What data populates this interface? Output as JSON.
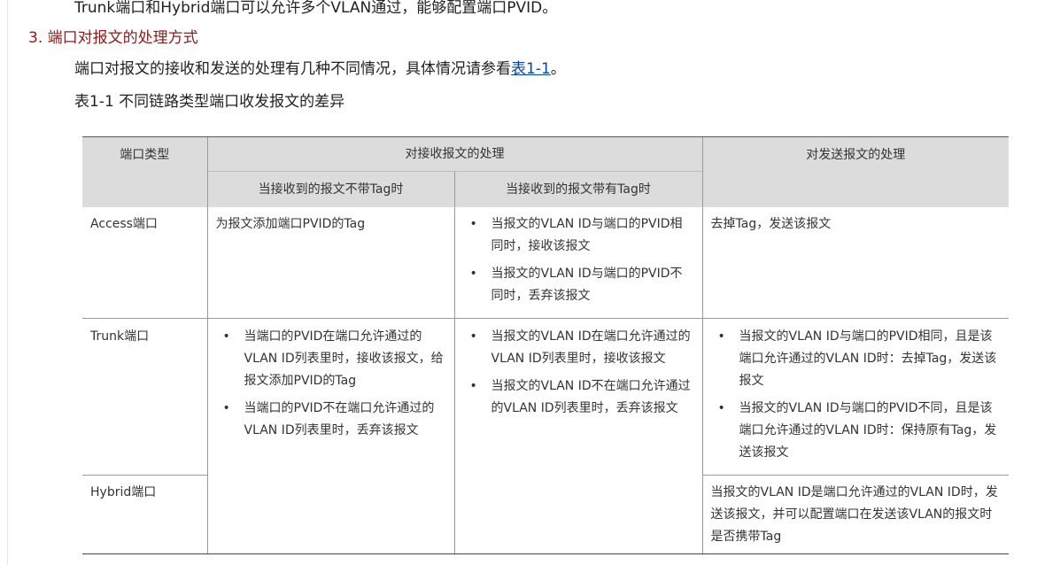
{
  "intro_line": "Trunk端口和Hybrid端口可以允许多个VLAN通过，能够配置端口PVID。",
  "section": {
    "heading": "3. 端口对报文的处理方式",
    "paragraph_before_link": "端口对报文的接收和发送的处理有几种不同情况，具体情况请参看",
    "link_text": "表1-1",
    "paragraph_after_link": "。",
    "table_caption": "表1-1 不同链路类型端口收发报文的差异"
  },
  "table": {
    "headers": {
      "port_type": "端口类型",
      "receive": "对接收报文的处理",
      "receive_untagged": "当接收到的报文不带Tag时",
      "receive_tagged": "当接收到的报文带有Tag时",
      "send": "对发送报文的处理"
    },
    "rows": {
      "access": {
        "name": "Access端口",
        "untagged": "为报文添加端口PVID的Tag",
        "tagged": [
          "当报文的VLAN ID与端口的PVID相同时，接收该报文",
          "当报文的VLAN ID与端口的PVID不同时，丢弃该报文"
        ],
        "send": "去掉Tag，发送该报文"
      },
      "trunk": {
        "name": "Trunk端口",
        "untagged": [
          "当端口的PVID在端口允许通过的VLAN ID列表里时，接收该报文，给报文添加PVID的Tag",
          "当端口的PVID不在端口允许通过的VLAN ID列表里时，丢弃该报文"
        ],
        "tagged": [
          "当报文的VLAN ID在端口允许通过的VLAN ID列表里时，接收该报文",
          "当报文的VLAN ID不在端口允许通过的VLAN ID列表里时，丢弃该报文"
        ],
        "send": [
          "当报文的VLAN ID与端口的PVID相同，且是该端口允许通过的VLAN ID时：去掉Tag，发送该报文",
          "当报文的VLAN ID与端口的PVID不同，且是该端口允许通过的VLAN ID时：保持原有Tag，发送该报文"
        ]
      },
      "hybrid": {
        "name": "Hybrid端口",
        "send": "当报文的VLAN ID是端口允许通过的VLAN ID时，发送该报文，并可以配置端口在发送该VLAN的报文时是否携带Tag"
      }
    }
  },
  "colors": {
    "heading": "#8b1a1a",
    "link": "#0645ad",
    "header_bg": "#dcdcdc"
  }
}
